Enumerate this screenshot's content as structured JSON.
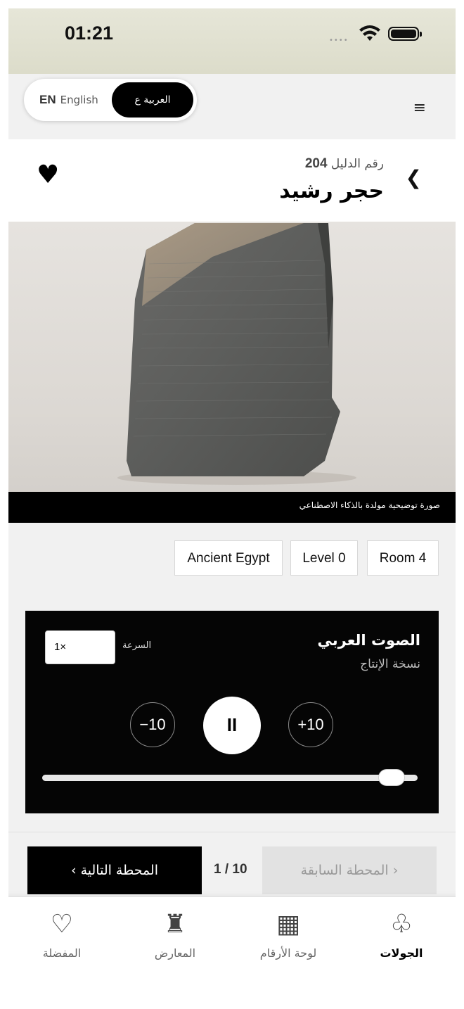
{
  "status_bar": {
    "time": "01:21",
    "signal": "••••"
  },
  "header": {
    "lang_en_code": "EN",
    "lang_en_label": "English",
    "lang_ar_label": "العربية ع",
    "menu_icon": "≡"
  },
  "object": {
    "catalog_label": "رقم الدليل",
    "catalog_number": "204",
    "title": "حجر رشيد",
    "favorite_icon": "♥",
    "back_icon": "❮",
    "image_caption": "صورة توضيحية مولدة بالذكاء الاصطناعي"
  },
  "tags": [
    "Ancient Egypt",
    "Level 0",
    "Room 4"
  ],
  "player": {
    "title": "الصوت العربي",
    "subtitle": "نسخة الإنتاج",
    "speed_label": "السرعة",
    "speed_value": "1×",
    "rewind_label": "−10",
    "play_icon": "II",
    "forward_label": "+10",
    "progress": 0.93
  },
  "navigation": {
    "next_label": "المحطة التالية ›",
    "counter": "1 / 10",
    "prev_label": "‹ المحطة السابقة"
  },
  "tabbar": {
    "items": [
      {
        "label": "المفضلة",
        "icon": "♡"
      },
      {
        "label": "المعارض",
        "icon": "♜"
      },
      {
        "label": "لوحة الأرقام",
        "icon": "▦"
      },
      {
        "label": "الجولات",
        "icon": "♧"
      }
    ],
    "active_index": 3
  }
}
